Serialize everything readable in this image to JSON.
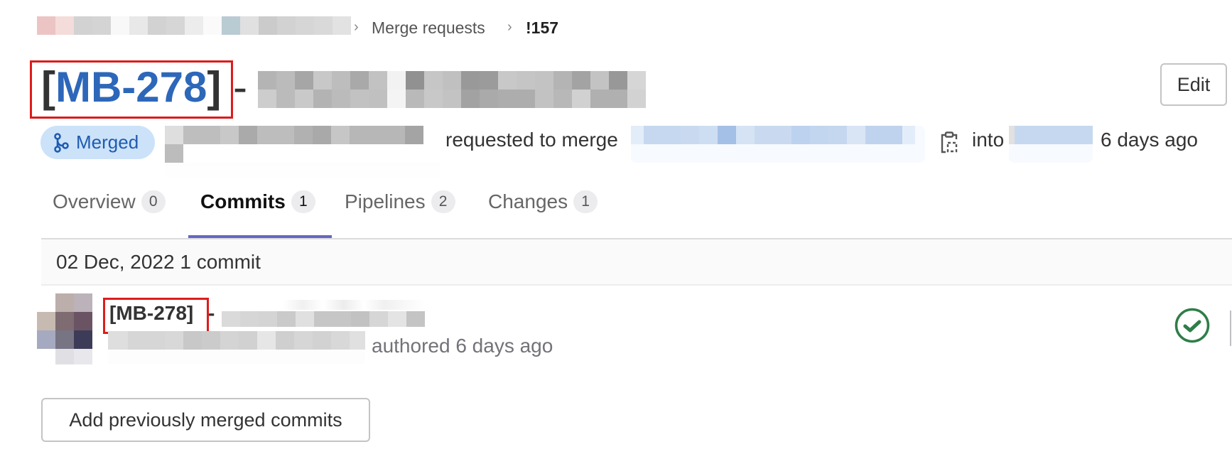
{
  "breadcrumb": {
    "items": [
      {
        "label": "[redacted project path]",
        "redacted": true
      },
      {
        "label": "Merge requests"
      },
      {
        "label": "!157",
        "current": true
      }
    ],
    "separator": "›"
  },
  "header": {
    "title_ref": "[MB-278]",
    "title_separator": "-",
    "title_rest": "[redacted]",
    "edit_label": "Edit"
  },
  "meta": {
    "status_badge": "Merged",
    "status_icon": "merge-icon",
    "author": "[redacted]",
    "requested_text": "requested to merge",
    "source_branch": "[redacted]",
    "copy_icon": "clipboard-icon",
    "into_text": "into",
    "target_branch": "[redacted]",
    "time": "6 days ago"
  },
  "tabs": [
    {
      "label": "Overview",
      "count": "0",
      "active": false
    },
    {
      "label": "Commits",
      "count": "1",
      "active": true
    },
    {
      "label": "Pipelines",
      "count": "2",
      "active": false
    },
    {
      "label": "Changes",
      "count": "1",
      "active": false
    }
  ],
  "commits": {
    "date_header": "02 Dec, 2022 1 commit",
    "items": [
      {
        "title_ref": "[MB-278]",
        "title_separator": "-",
        "title_rest": "[redacted]",
        "author": "[redacted]",
        "authored_text": "authored 6 days ago",
        "status_icon": "status-success-icon"
      }
    ]
  },
  "actions": {
    "add_previously_merged": "Add previously merged commits"
  },
  "colors": {
    "accent_purple": "#6666c4",
    "merged_badge_bg": "#cbe2f9",
    "merged_badge_text": "#1f5bb0",
    "title_link": "#2d67b9",
    "highlight_red": "#dd1c1c",
    "success_green": "#2f7d47"
  }
}
